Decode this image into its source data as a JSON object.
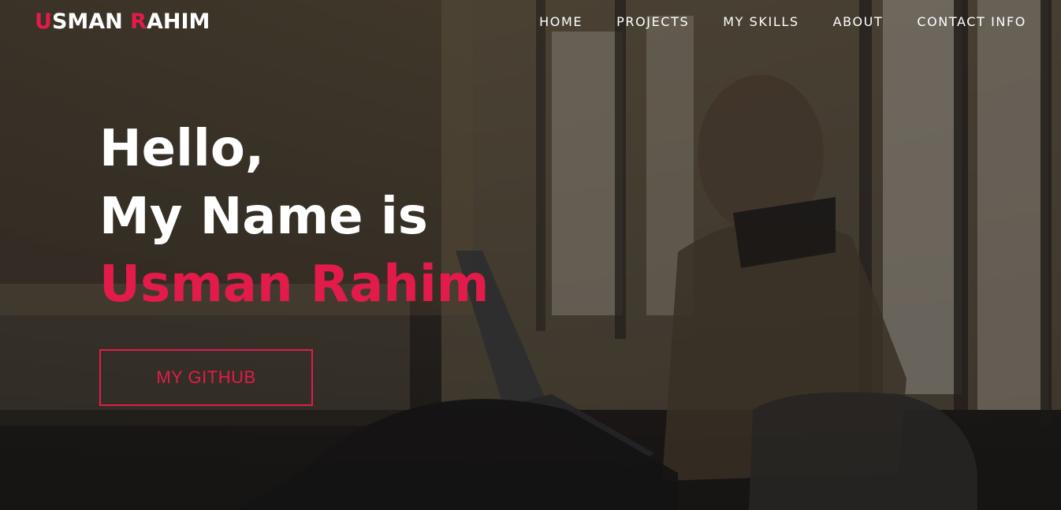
{
  "logo": {
    "first_initial": "U",
    "first_rest": "SMAN ",
    "last_initial": "R",
    "last_rest": "AHIM"
  },
  "nav": {
    "items": [
      {
        "label": "HOME"
      },
      {
        "label": "PROJECTS"
      },
      {
        "label": "MY SKILLS"
      },
      {
        "label": "ABOUT"
      },
      {
        "label": "CONTACT INFO"
      }
    ]
  },
  "hero": {
    "line1": "Hello,",
    "line2": "My Name is",
    "name": "Usman Rahim",
    "button_label": "MY GITHUB"
  },
  "colors": {
    "accent": "#e31b4b",
    "text": "#ffffff"
  }
}
